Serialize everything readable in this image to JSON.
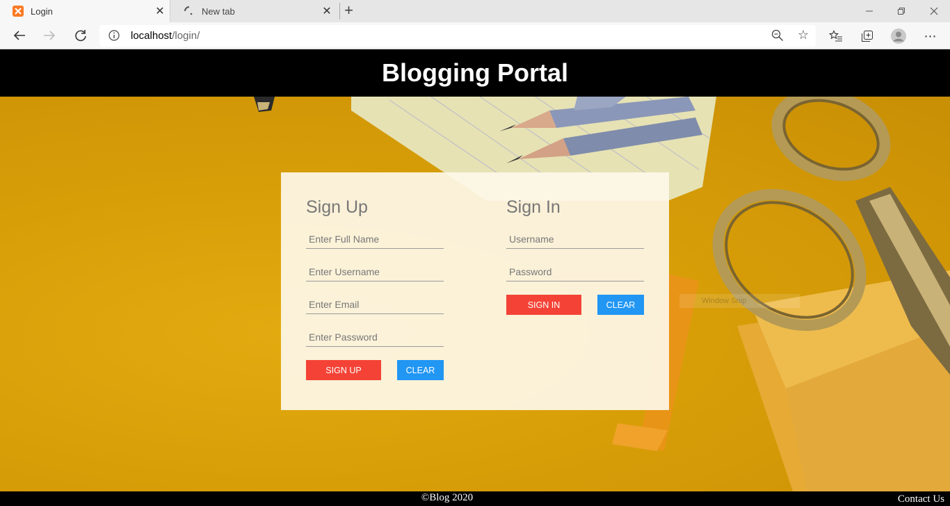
{
  "browser": {
    "tabs": [
      {
        "title": "Login",
        "active": true
      },
      {
        "title": "New tab",
        "active": false
      }
    ],
    "new_tab_glyph": "+",
    "address": {
      "host": "localhost",
      "path": "/login/"
    },
    "icons": [
      "back-icon",
      "forward-icon",
      "refresh-icon",
      "info-icon",
      "zoom-icon",
      "star-icon",
      "favorites-icon",
      "collections-icon",
      "profile-icon",
      "more-icon",
      "minimize-icon",
      "restore-icon",
      "close-icon"
    ]
  },
  "page": {
    "title": "Blogging Portal",
    "signup": {
      "heading": "Sign Up",
      "fullname_placeholder": "Enter Full Name",
      "username_placeholder": "Enter Username",
      "email_placeholder": "Enter Email",
      "password_placeholder": "Enter Password",
      "submit_label": "SIGN UP",
      "clear_label": "CLEAR"
    },
    "signin": {
      "heading": "Sign In",
      "username_placeholder": "Username",
      "password_placeholder": "Password",
      "submit_label": "SIGN IN",
      "clear_label": "CLEAR"
    },
    "overlay_snip": "Window Snip",
    "footer": {
      "copyright": "©Blog 2020",
      "contact": "Contact Us"
    }
  },
  "colors": {
    "header_bg": "#000000",
    "signup_button": "#f44336",
    "clear_button": "#2196f3",
    "background": "#dca308"
  }
}
